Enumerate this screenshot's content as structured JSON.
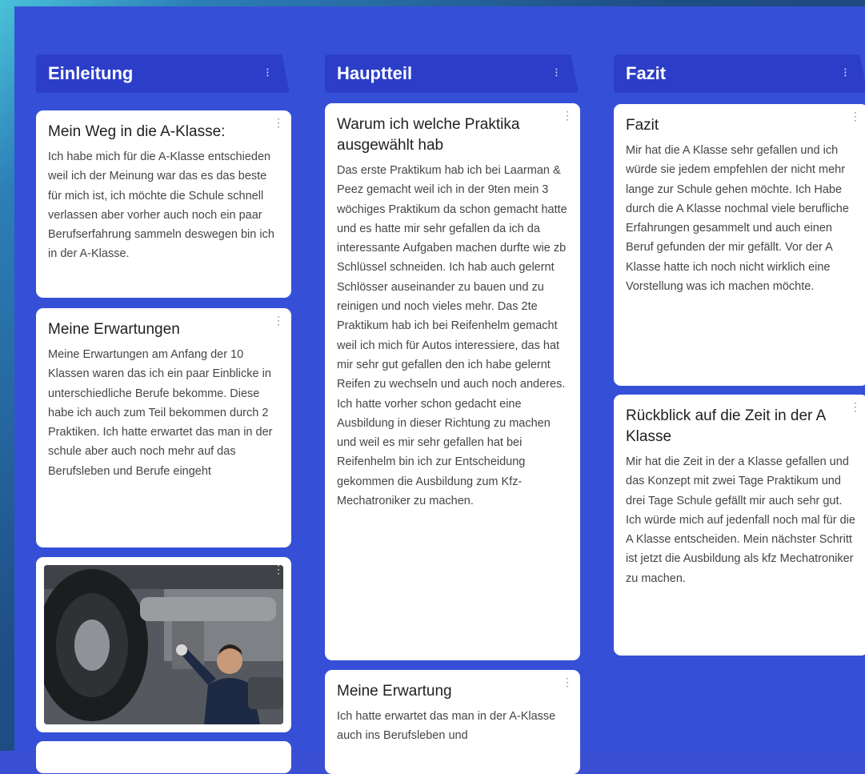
{
  "columns": [
    {
      "title": "Einleitung",
      "cards": [
        {
          "title": "Mein Weg in die A-Klasse:",
          "body": "Ich habe mich für die A-Klasse entschieden weil ich der Meinung war das es das beste für mich ist, ich möchte die Schule schnell verlassen aber vorher auch noch ein paar Berufserfahrung sammeln deswegen bin ich in der A-Klasse."
        },
        {
          "title": "Meine Erwartungen",
          "body": "Meine Erwartungen am Anfang der 10 Klassen waren das ich ein paar Einblicke in unterschiedliche Berufe bekomme. Diese habe ich auch zum Teil bekommen durch 2 Praktiken. Ich hatte erwartet das man in der schule aber auch noch mehr auf das Berufsleben und Berufe eingeht"
        }
      ]
    },
    {
      "title": "Hauptteil",
      "cards": [
        {
          "title": "Warum ich welche Praktika ausgewählt hab",
          "body": "Das erste Praktikum hab ich bei Laarman & Peez gemacht weil ich in der 9ten mein 3 wöchiges Praktikum da schon gemacht hatte und es hatte mir sehr gefallen da ich da interessante Aufgaben machen durfte wie zb Schlüssel schneiden. Ich hab auch gelernt Schlösser auseinander zu bauen und zu reinigen und noch vieles mehr. Das 2te Praktikum hab ich bei Reifenhelm gemacht weil ich mich für Autos interessiere, das hat mir sehr gut gefallen den ich habe gelernt Reifen zu wechseln und auch noch anderes. Ich hatte vorher schon gedacht eine Ausbildung in dieser Richtung zu machen und weil es mir sehr gefallen hat bei Reifenhelm bin ich zur Entscheidung gekommen die Ausbildung zum Kfz-Mechatroniker zu machen."
        },
        {
          "title": "Meine Erwartung",
          "body": "Ich hatte erwartet das man in der A-Klasse auch ins Berufsleben und"
        }
      ]
    },
    {
      "title": "Fazit",
      "cards": [
        {
          "title": "Fazit",
          "body": "Mir hat die A Klasse sehr gefallen und ich würde sie jedem empfehlen der nicht mehr lange zur Schule gehen möchte. Ich Habe durch die A Klasse nochmal viele berufliche Erfahrungen gesammelt und auch einen Beruf gefunden der mir gefällt. Vor der A Klasse hatte ich noch nicht wirklich eine Vorstellung was ich machen möchte."
        },
        {
          "title": "Rückblick auf die Zeit in der A Klasse",
          "body": "Mir hat die Zeit in der a Klasse gefallen und das Konzept mit zwei Tage Praktikum und drei Tage Schule gefällt mir auch sehr gut. Ich würde mich auf jedenfall noch mal für die A Klasse entscheiden. Mein nächster Schritt ist jetzt die Ausbildung als kfz Mechatroniker zu machen."
        }
      ]
    }
  ],
  "icons": {
    "column_menu": "⁝",
    "card_menu": "⋮"
  },
  "colors": {
    "board": "#3550d6",
    "column_header": "#2c3ec8",
    "card": "#ffffff"
  }
}
